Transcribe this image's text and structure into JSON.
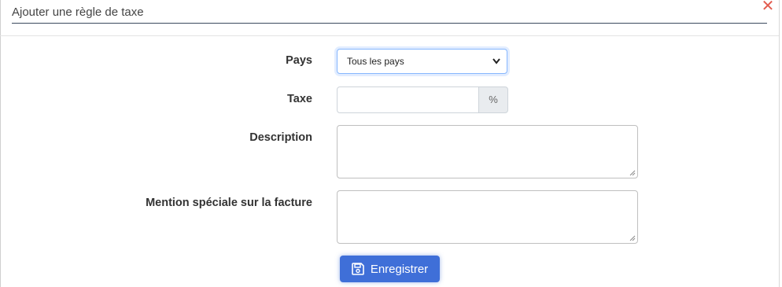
{
  "modal": {
    "title": "Ajouter une règle de taxe",
    "close_icon": "close-x-icon"
  },
  "form": {
    "pays": {
      "label": "Pays",
      "selected": "Tous les pays"
    },
    "taxe": {
      "label": "Taxe",
      "value": "",
      "suffix": "%"
    },
    "description": {
      "label": "Description",
      "value": ""
    },
    "mention": {
      "label": "Mention spéciale sur la facture",
      "value": ""
    }
  },
  "actions": {
    "save_label": "Enregistrer",
    "save_icon": "floppy-disk-icon"
  },
  "colors": {
    "primary": "#3f6fd8",
    "close": "#e25c4f",
    "focus_border": "#86b7fe"
  }
}
